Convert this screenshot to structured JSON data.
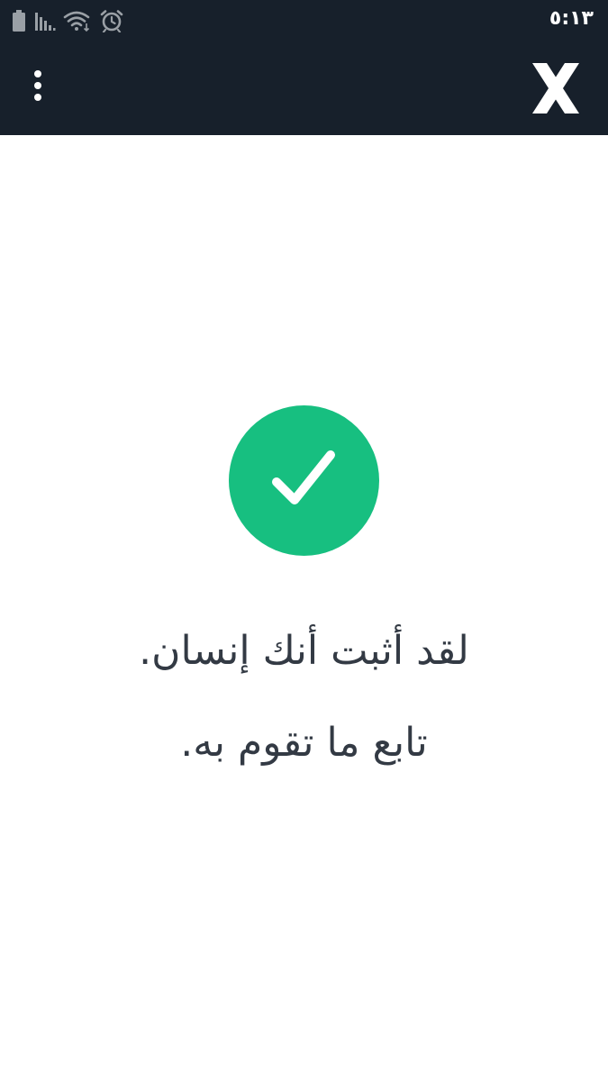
{
  "status_bar": {
    "time": "٥:١٣",
    "icons": [
      "battery-icon",
      "signal-icon",
      "wifi-icon",
      "alarm-icon"
    ]
  },
  "app_bar": {
    "menu_icon": "more-vertical-icon",
    "logo_icon": "x-logo-icon"
  },
  "verification": {
    "icon": "check-circle-icon",
    "line1": "لقد أثبت أنك إنسان.",
    "line2": "تابع ما تقوم به."
  },
  "colors": {
    "top_bar": "#17202b",
    "success_green": "#17bf80",
    "text": "#333a44",
    "background": "#ffffff"
  }
}
